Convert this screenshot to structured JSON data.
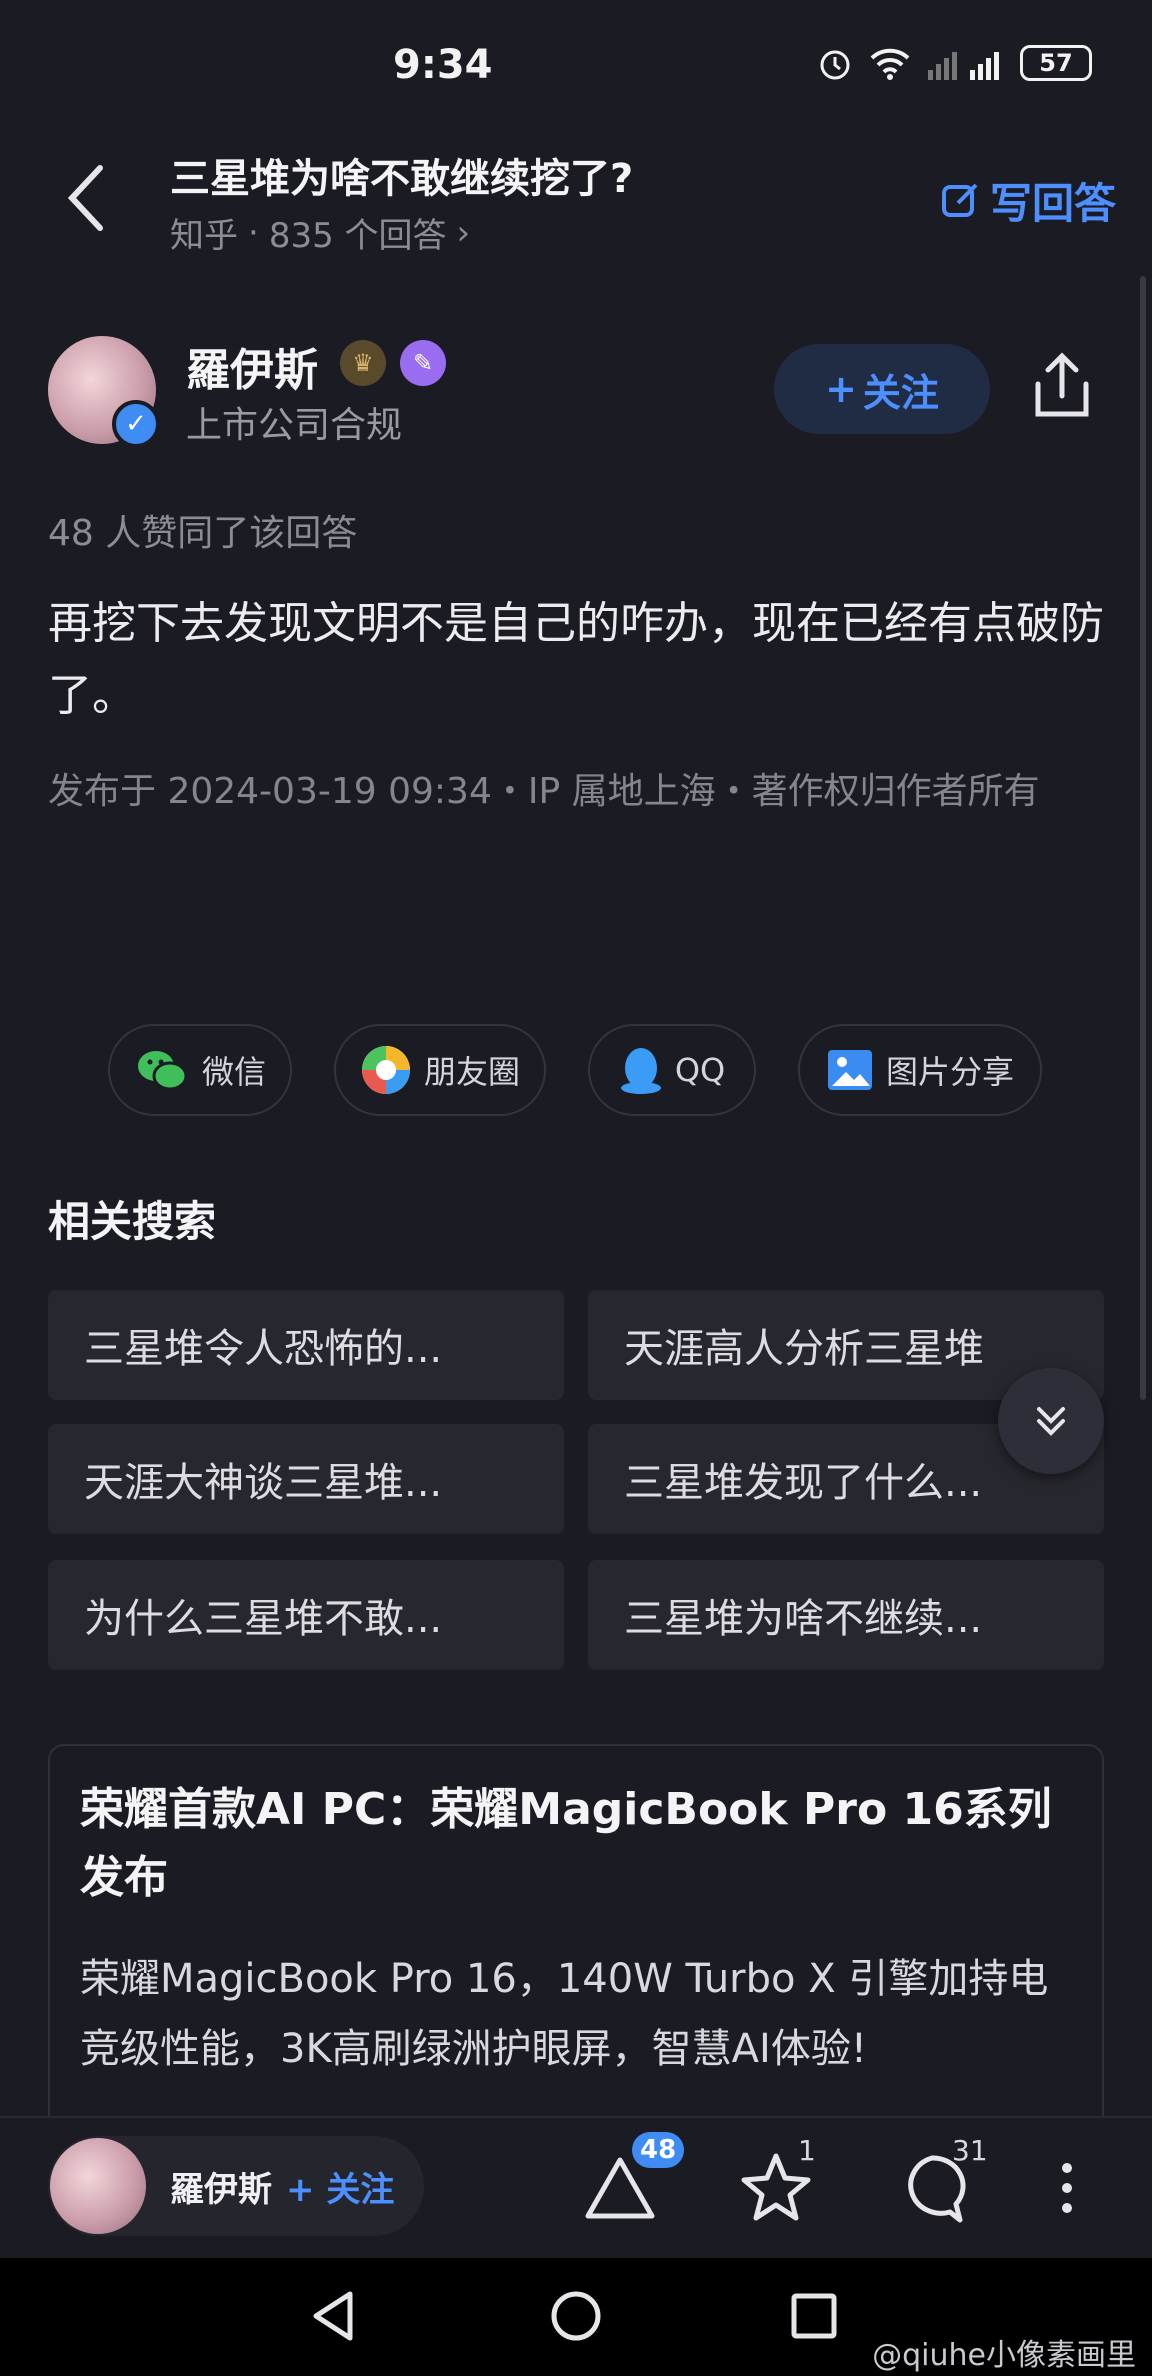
{
  "status_bar": {
    "time": "9:34",
    "battery": "57"
  },
  "header": {
    "question_title": "三星堆为啥不敢继续挖了?",
    "source": "知乎",
    "dot": "·",
    "answer_count": "835 个回答",
    "write_answer": "写回答"
  },
  "author": {
    "name": "羅伊斯",
    "title": "上市公司合规",
    "follow_label": "关注",
    "follow_plus": "+"
  },
  "answer": {
    "likes_text": "48 人赞同了该回答",
    "content": "再挖下去发现文明不是自己的咋办，现在已经有点破防了。",
    "meta": "发布于 2024-03-19 09:34・IP 属地上海・著作权归作者所有"
  },
  "share": [
    {
      "label": "微信",
      "icon": "wechat-icon"
    },
    {
      "label": "朋友圈",
      "icon": "moments-icon"
    },
    {
      "label": "QQ",
      "icon": "qq-icon"
    },
    {
      "label": "图片分享",
      "icon": "image-share-icon"
    }
  ],
  "related": {
    "title": "相关搜索",
    "items": [
      "三星堆令人恐怖的...",
      "天涯高人分析三星堆",
      "天涯大神谈三星堆...",
      "三星堆发现了什么...",
      "为什么三星堆不敢...",
      "三星堆为啥不继续..."
    ]
  },
  "ad": {
    "title": "荣耀首款AI PC：荣耀MagicBook Pro 16系列发布",
    "description": "荣耀MagicBook Pro 16，140W Turbo X 引擎加持电竞级性能，3K高刷绿洲护眼屏，智慧AI体验!"
  },
  "bottom_bar": {
    "author_name": "羅伊斯",
    "follow_label": "+ 关注",
    "vote_count": "48",
    "favorite_count": "1",
    "comment_count": "31"
  },
  "watermark": "@qiuhe小像素画里",
  "colors": {
    "accent": "#4d8fff",
    "background": "#1b1b24",
    "badge": "#3f8cf5"
  }
}
